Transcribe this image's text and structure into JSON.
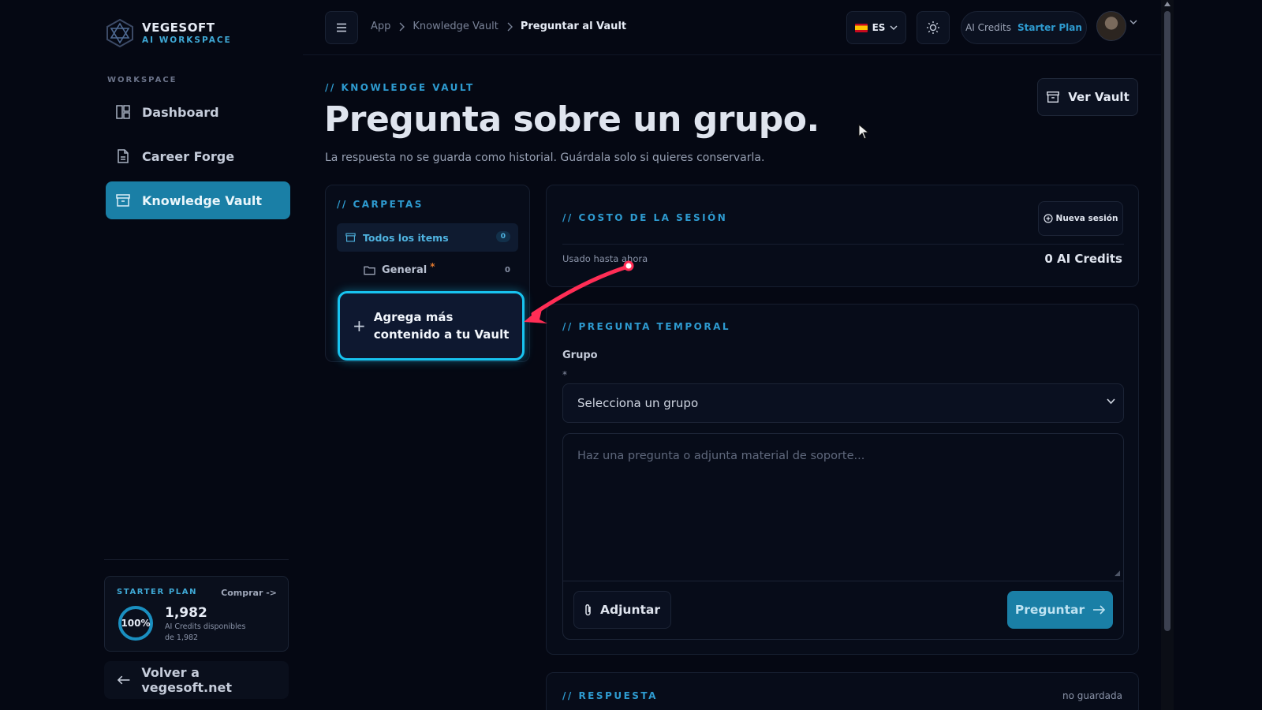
{
  "brand": {
    "name": "VEGESOFT",
    "sub": "AI WORKSPACE"
  },
  "sidebar": {
    "section_label": "WORKSPACE",
    "items": [
      {
        "label": "Dashboard",
        "icon": "dashboard-icon"
      },
      {
        "label": "Career Forge",
        "icon": "document-icon"
      },
      {
        "label": "Knowledge Vault",
        "icon": "archive-icon",
        "active": true
      }
    ],
    "plan": {
      "label": "STARTER PLAN",
      "buy": "Comprar ->",
      "percent": "100%",
      "percent_value": 100,
      "credits": "1,982",
      "available": "AI Credits disponibles",
      "of": "de 1,982"
    },
    "back": "Volver a vegesoft.net"
  },
  "topbar": {
    "breadcrumb": [
      "App",
      "Knowledge Vault",
      "Preguntar al Vault"
    ],
    "lang": "ES",
    "credits_label": "AI Credits",
    "plan_name": "Starter Plan"
  },
  "main": {
    "eyebrow": "// KNOWLEDGE VAULT",
    "title": "Pregunta sobre un grupo.",
    "subtitle": "La respuesta no se guarda como historial. Guárdala solo si quieres conservarla.",
    "ver_vault": "Ver Vault"
  },
  "folders": {
    "eyebrow": "// CARPETAS",
    "all_items": "Todos los items",
    "all_count": "0",
    "general": "General",
    "general_star": "*",
    "general_count": "0",
    "add_content": [
      "Agrega más",
      "contenido a tu Vault"
    ]
  },
  "session": {
    "eyebrow": "// COSTO DE LA SESIÓN",
    "new_session": "Nueva sesión",
    "used_label": "Usado hasta ahora",
    "used_value": "0 AI Credits"
  },
  "question": {
    "eyebrow": "// PREGUNTA TEMPORAL",
    "group_label": "Grupo",
    "required": "*",
    "select_value": "Selecciona un grupo",
    "placeholder": "Haz una pregunta o adjunta material de soporte...",
    "attach": "Adjuntar",
    "ask": "Preguntar"
  },
  "answer": {
    "eyebrow": "// RESPUESTA",
    "status": "no guardada"
  },
  "colors": {
    "accent": "#1a7fa6",
    "eyebrow": "#2e9bd0",
    "highlight": "#18c3f0",
    "annotation": "#ff2d55"
  }
}
